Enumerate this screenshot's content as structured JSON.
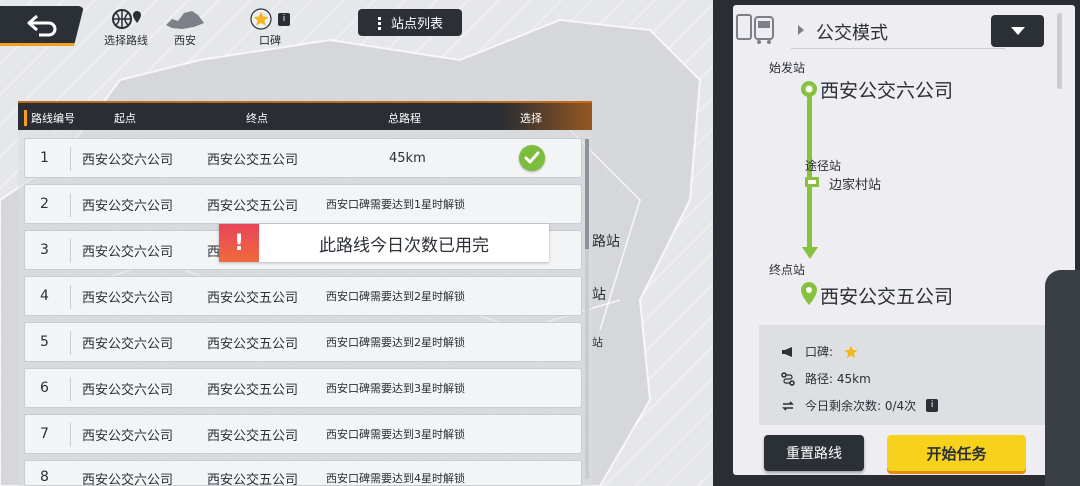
{
  "top_bar": {
    "select_route_label": "选择路线",
    "city_label": "西安",
    "reputation_label": "口碑",
    "info_badge": "i",
    "station_list_label": "站点列表"
  },
  "route_table": {
    "headers": {
      "route_no": "路线编号",
      "start": "起点",
      "end": "终点",
      "distance": "总路程",
      "select": "选择"
    },
    "rows": [
      {
        "num": "1",
        "from": "西安公交六公司",
        "to": "西安公交五公司",
        "distance": "45km",
        "lock": "",
        "selected": true
      },
      {
        "num": "2",
        "from": "西安公交六公司",
        "to": "西安公交五公司",
        "distance": "",
        "lock": "西安口碑需要达到1星时解锁",
        "selected": false
      },
      {
        "num": "3",
        "from": "西安公交六公司",
        "to": "西",
        "distance": "",
        "lock": "",
        "selected": false
      },
      {
        "num": "4",
        "from": "西安公交六公司",
        "to": "西安公交五公司",
        "distance": "",
        "lock": "西安口碑需要达到2星时解锁",
        "selected": false
      },
      {
        "num": "5",
        "from": "西安公交六公司",
        "to": "西安公交五公司",
        "distance": "",
        "lock": "西安口碑需要达到2星时解锁",
        "selected": false
      },
      {
        "num": "6",
        "from": "西安公交六公司",
        "to": "西安公交五公司",
        "distance": "",
        "lock": "西安口碑需要达到3星时解锁",
        "selected": false
      },
      {
        "num": "7",
        "from": "西安公交六公司",
        "to": "西安公交五公司",
        "distance": "",
        "lock": "西安口碑需要达到3星时解锁",
        "selected": false
      },
      {
        "num": "8",
        "from": "西安公交六公司",
        "to": "西安公交五公司",
        "distance": "",
        "lock": "西安口碑需要达到4星时解锁",
        "selected": false
      }
    ]
  },
  "toast": {
    "icon": "!",
    "message": "此路线今日次数已用完"
  },
  "map_labels": [
    "路站",
    "站",
    "站"
  ],
  "detail": {
    "mode_title": "公交模式",
    "start_label": "始发站",
    "start_station": "西安公交六公司",
    "via_label": "途径站",
    "via_station": "边家村站",
    "end_label": "终点站",
    "end_station": "西安公交五公司",
    "reputation_label": "口碑:",
    "distance_text": "路径: 45km",
    "remaining_text": "今日剩余次数: 0/4次",
    "info_badge": "i",
    "reset_button": "重置路线",
    "start_button": "开始任务"
  },
  "colors": {
    "accent_green": "#86c23f",
    "accent_yellow": "#f7d21d",
    "accent_orange": "#f4a019",
    "dark": "#2b2f36",
    "warn_red": "#e8445a"
  }
}
